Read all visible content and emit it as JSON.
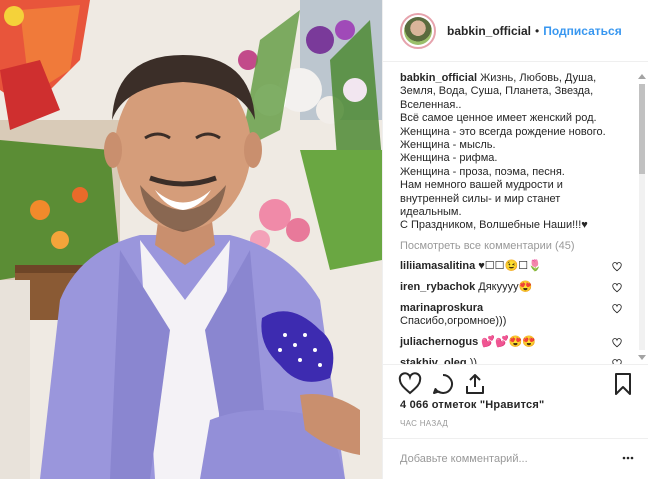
{
  "header": {
    "username": "babkin_official",
    "separator": "•",
    "follow_label": "Подписаться"
  },
  "caption": {
    "author": "babkin_official",
    "lines": [
      "Жизнь, Любовь, Душа,",
      "Земля, Вода, Суша, Планета, Звезда,",
      "Вселенная..",
      "Всё самое ценное имеет женский род.",
      "Женщина - это всегда рождение нового.",
      "Женщина - мысль.",
      "Женщина - рифма.",
      "Женщина - проза, поэма, песня.",
      "Нам немного вашей мудрости и",
      "внутренней силы- и мир станет",
      "идеальным.",
      "С Праздником, Волшебные Наши!!!♥"
    ]
  },
  "view_all_comments": "Посмотреть все комментарии (45)",
  "comments": [
    {
      "user": "liliiamasalitina",
      "text": "♥☐☐😉☐🌷"
    },
    {
      "user": "iren_rybachok",
      "text": "Дякуууу😍"
    },
    {
      "user": "marinaproskura",
      "text": "Спасибо,огромное)))"
    },
    {
      "user": "juliachernogus",
      "text": "💕💕😍😍"
    },
    {
      "user": "stakhiv_oleg",
      "text": "))"
    }
  ],
  "likes_text": "4 066 отметок \"Нравится\"",
  "time_text": "ЧАС НАЗАД",
  "add_comment_placeholder": "Добавьте комментарий...",
  "icons": {
    "like": "heart-icon",
    "comment": "comment-icon",
    "share": "share-icon",
    "save": "bookmark-icon",
    "more": "more-dots-icon"
  },
  "colors": {
    "link_blue": "#3897f0",
    "avatar_ring": "#e6a3ad",
    "muted": "#999999",
    "text": "#262626"
  }
}
